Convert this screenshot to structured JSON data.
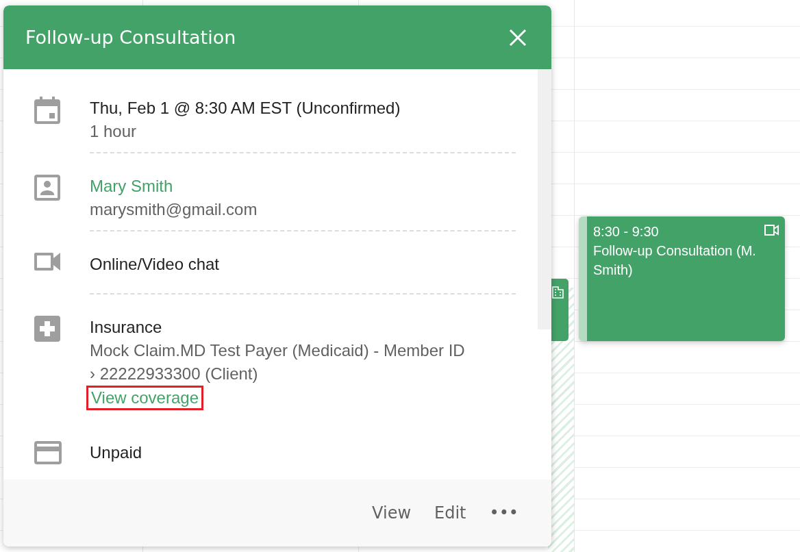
{
  "calendar_event": {
    "time": "8:30 - 9:30",
    "title": "Follow-up Consultation (M. Smith)",
    "kind": "video"
  },
  "popup": {
    "title": "Follow-up Consultation",
    "details": [
      {
        "kind": "date",
        "primary": "Thu, Feb 1 @ 8:30 AM EST (Unconfirmed)",
        "secondary": [
          "1 hour"
        ],
        "divider": true
      },
      {
        "kind": "client",
        "primary": "Mary Smith",
        "secondary": [
          "marysmith@gmail.com"
        ],
        "divider": true
      },
      {
        "kind": "video",
        "primary": "Online/Video chat",
        "divider": true
      },
      {
        "kind": "insurance",
        "primary": "Insurance",
        "secondary": [
          "Mock Claim.MD Test Payer (Medicaid) - Member ID › 22222933300 (Client)"
        ],
        "link": {
          "label": "View coverage",
          "highlighted": true
        },
        "divider": false
      },
      {
        "kind": "billing",
        "primary": "Unpaid",
        "divider": false
      }
    ],
    "actions": [
      "View",
      "Edit",
      "•••"
    ]
  }
}
